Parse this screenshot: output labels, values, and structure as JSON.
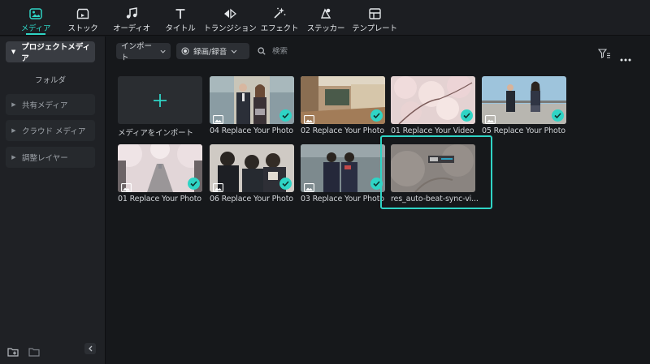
{
  "toolbar": {
    "items": [
      {
        "label": "メディア",
        "icon": "media-icon"
      },
      {
        "label": "ストック",
        "icon": "stock-icon"
      },
      {
        "label": "オーディオ",
        "icon": "audio-note-icon"
      },
      {
        "label": "タイトル",
        "icon": "title-T-icon"
      },
      {
        "label": "トランジション",
        "icon": "transition-arrows-icon"
      },
      {
        "label": "エフェクト",
        "icon": "effect-sparkle-icon"
      },
      {
        "label": "ステッカー",
        "icon": "sticker-icon"
      },
      {
        "label": "テンプレート",
        "icon": "template-icon"
      }
    ],
    "active_index": 0
  },
  "sidebar": {
    "project_media": "プロジェクトメディア",
    "folder": "フォルダ",
    "shared_media": "共有メディア",
    "cloud_media": "クラウド メディア",
    "adjustment_layer": "調整レイヤー"
  },
  "filterbar": {
    "import_label": "インポート",
    "record_label": "録画/録音",
    "search_placeholder": "検索"
  },
  "media": {
    "import_label": "メディアをインポート",
    "items": [
      {
        "caption": "04 Replace Your Photo",
        "kind": "photo",
        "checked": true
      },
      {
        "caption": "02 Replace Your Photo",
        "kind": "photo",
        "checked": true
      },
      {
        "caption": "01 Replace Your Video",
        "kind": "video",
        "checked": true
      },
      {
        "caption": "05 Replace Your Photo",
        "kind": "photo",
        "checked": true
      },
      {
        "caption": "01 Replace Your Photo",
        "kind": "photo",
        "checked": true
      },
      {
        "caption": "06 Replace Your Photo",
        "kind": "photo",
        "checked": true
      },
      {
        "caption": "03 Replace Your Photo",
        "kind": "photo",
        "checked": true
      },
      {
        "caption": "res_auto-beat-sync-vi...",
        "kind": "video",
        "checked": false,
        "selected": true
      }
    ]
  },
  "colors": {
    "accent": "#2fd4c5",
    "background": "#16181b",
    "panel": "#1f2125"
  }
}
